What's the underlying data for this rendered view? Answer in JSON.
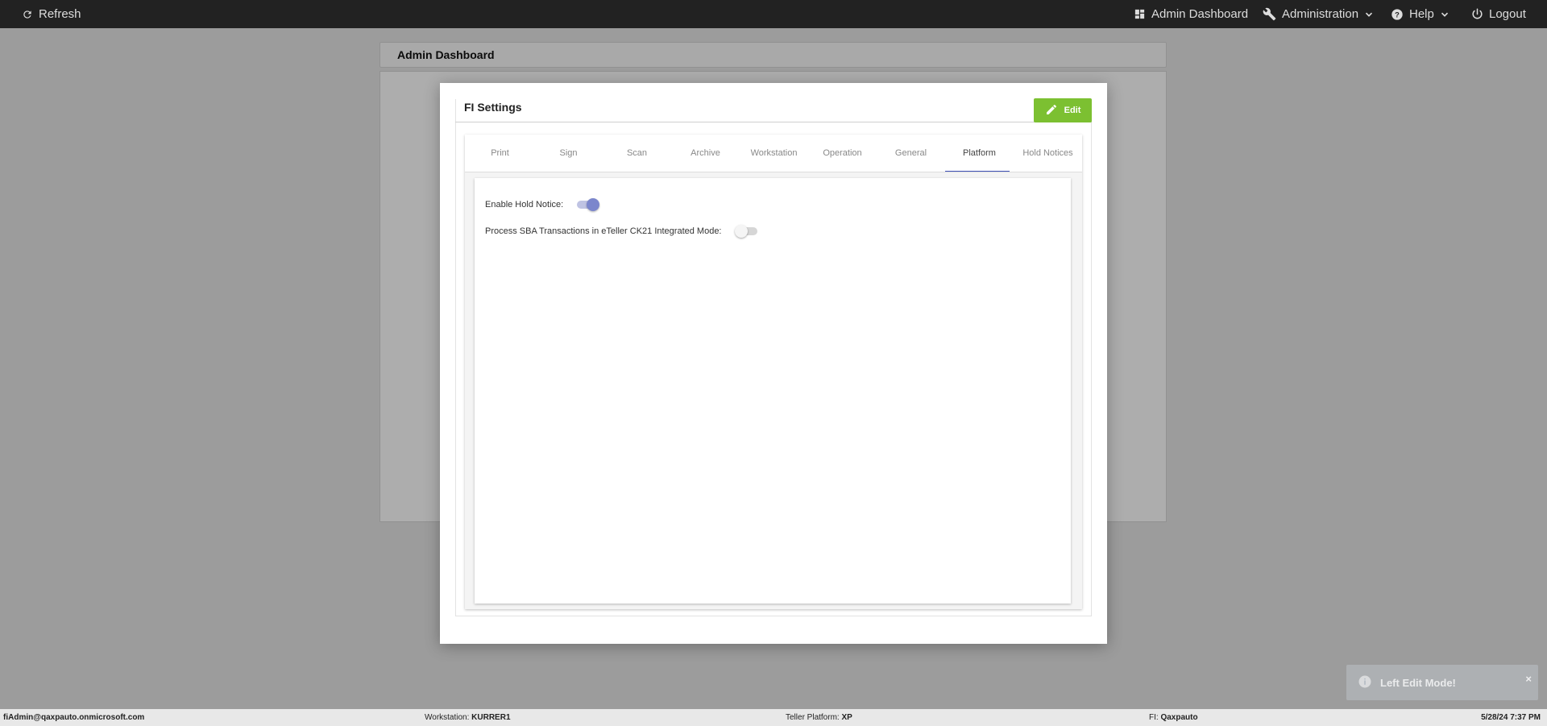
{
  "topbar": {
    "refresh_label": "Refresh",
    "admin_dashboard_label": "Admin Dashboard",
    "administration_label": "Administration",
    "help_label": "Help",
    "logout_label": "Logout"
  },
  "page": {
    "header_title": "Admin Dashboard"
  },
  "modal": {
    "title": "FI Settings",
    "edit_label": "Edit",
    "tabs": [
      {
        "label": "Print"
      },
      {
        "label": "Sign"
      },
      {
        "label": "Scan"
      },
      {
        "label": "Archive"
      },
      {
        "label": "Workstation"
      },
      {
        "label": "Operation"
      },
      {
        "label": "General"
      },
      {
        "label": "Platform",
        "active": true
      },
      {
        "label": "Hold Notices"
      }
    ],
    "settings": [
      {
        "label": "Enable Hold Notice:",
        "enabled": true
      },
      {
        "label": "Process SBA Transactions in eTeller CK21 Integrated Mode:",
        "enabled": false
      }
    ]
  },
  "toast": {
    "message": "Left Edit Mode!",
    "close_symbol": "×"
  },
  "statusbar": {
    "user": "fiAdmin@qaxpauto.onmicrosoft.com",
    "workstation_label": "Workstation:",
    "workstation_value": "KURRER1",
    "teller_platform_label": "Teller Platform:",
    "teller_platform_value": "XP",
    "fi_label": "FI:",
    "fi_value": "Qaxpauto",
    "datetime": "5/28/24 7:37 PM"
  },
  "colors": {
    "topbar_bg": "#222222",
    "edit_button": "#7cc031",
    "tab_indicator": "#3f51b5",
    "toggle_on": "#7b86cc"
  }
}
